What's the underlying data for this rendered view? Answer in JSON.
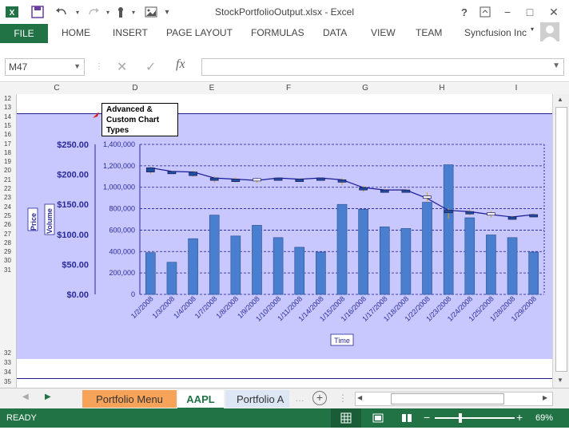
{
  "window": {
    "title": "StockPortfolioOutput.xlsx - Excel",
    "help": "?",
    "controls": [
      "−",
      "□",
      "✕"
    ]
  },
  "ribbon": {
    "file": "FILE",
    "tabs": [
      "HOME",
      "INSERT",
      "PAGE LAYOUT",
      "FORMULAS",
      "DATA",
      "VIEW",
      "TEAM"
    ],
    "account": "Syncfusion Inc"
  },
  "formula_bar": {
    "name_box": "M47",
    "fx": "fx",
    "value": ""
  },
  "columns": [
    "C",
    "D",
    "E",
    "F",
    "G",
    "H",
    "I"
  ],
  "rows": [
    "12",
    "13",
    "14",
    "15",
    "16",
    "17",
    "18",
    "19",
    "20",
    "21",
    "22",
    "23",
    "24",
    "25",
    "26",
    "27",
    "28",
    "29",
    "30",
    "31",
    "32",
    "33",
    "34",
    "35"
  ],
  "callout": {
    "line1": "Advanced &",
    "line2": "Custom Chart",
    "line3": "Types"
  },
  "chart_data": {
    "type": "bar",
    "categories": [
      "1/2/2008",
      "1/3/2008",
      "1/4/2008",
      "1/7/2008",
      "1/8/2008",
      "1/9/2008",
      "1/10/2008",
      "1/11/2008",
      "1/14/2008",
      "1/15/2008",
      "1/16/2008",
      "1/17/2008",
      "1/18/2008",
      "1/22/2008",
      "1/23/2008",
      "1/24/2008",
      "1/25/2008",
      "1/28/2008",
      "1/29/2008"
    ],
    "volume": [
      390000,
      300000,
      520000,
      740000,
      545000,
      645000,
      530000,
      440000,
      395000,
      840000,
      795000,
      630000,
      615000,
      860000,
      1210000,
      715000,
      555000,
      530000,
      395000
    ],
    "price_close": [
      211,
      205,
      204,
      194,
      192,
      190,
      194,
      192,
      194,
      191,
      178,
      174,
      174,
      160,
      140,
      138,
      133,
      129,
      133
    ],
    "price_open": [
      204,
      204,
      198,
      193,
      188,
      193,
      194,
      190,
      193,
      188,
      175,
      173,
      173,
      164,
      139,
      136,
      136,
      128,
      133
    ],
    "price_high": [
      213,
      206,
      206,
      197,
      195,
      194,
      195,
      194,
      195,
      194,
      181,
      176,
      176,
      170,
      143,
      141,
      139,
      131,
      135
    ],
    "price_low": [
      201,
      202,
      196,
      186,
      186,
      186,
      191,
      188,
      191,
      182,
      171,
      170,
      170,
      155,
      126,
      132,
      128,
      124,
      130
    ],
    "y_left_label": "Price",
    "y_left_ticks": [
      "$250.00",
      "$200.00",
      "$150.00",
      "$100.00",
      "$50.00",
      "$0.00"
    ],
    "y_left_range": [
      0,
      250
    ],
    "y_right_label": "Volume",
    "y_right_ticks": [
      "1,400,000",
      "1,200,000",
      "1,000,000",
      "800,000",
      "600,000",
      "400,000",
      "200,000",
      "0"
    ],
    "y_right_range": [
      0,
      1400000
    ],
    "xlabel": "Time",
    "colors": {
      "bar": "#4a7fd0",
      "line": "#1a1a9a",
      "bg": "#c8c8ff",
      "grid": "#1a1a9a"
    }
  },
  "sheet_tabs": [
    "Portfolio Menu",
    "AAPL",
    "Portfolio A"
  ],
  "status": {
    "ready": "READY",
    "zoom": "69%"
  }
}
